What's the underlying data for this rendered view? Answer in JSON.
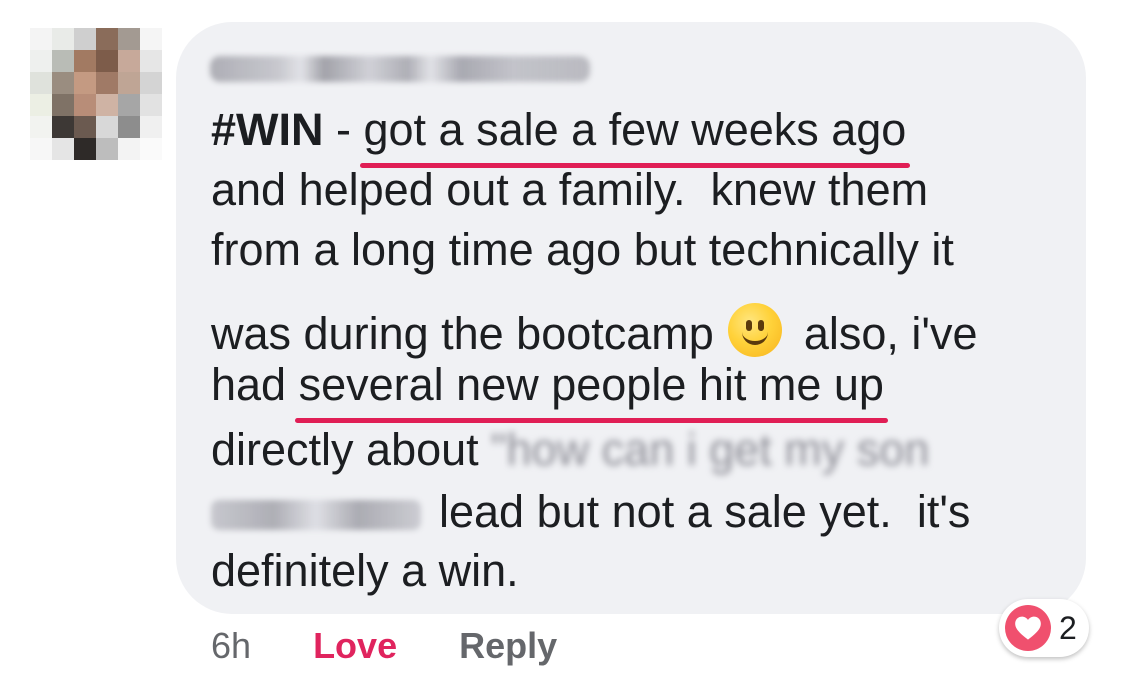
{
  "comment": {
    "hashtag": "#WIN",
    "separator": " - ",
    "underlined_1": "got a sale a few weeks ago",
    "line2": "and helped out a family.  knew them",
    "line3": "from a long time ago but technically it",
    "line4_before_emoji": "was during the bootcamp",
    "emoji": "slightly-smiling-face",
    "line4_after_emoji": "also, i've",
    "line5_prefix": "had",
    "underlined_2": "several new people hit me up",
    "line6_text": "directly about",
    "redacted_quote": "\"how can i get my son",
    "line7_text": "lead but not a sale yet.  it's",
    "line8": "definitely a win."
  },
  "actions": {
    "time": "6h",
    "love": "Love",
    "reply": "Reply"
  },
  "reactions": {
    "icon": "heart-icon",
    "count": "2"
  },
  "colors": {
    "bubble_bg": "#f0f1f4",
    "underline": "#e01e55",
    "love": "#e0245e",
    "meta": "#65676b",
    "heart": "#f0506e"
  }
}
